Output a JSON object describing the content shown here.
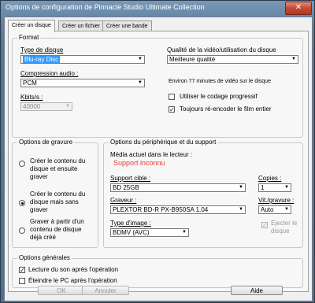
{
  "window": {
    "title": "Options de configuration de Pinnacle Studio Ultimate Collection",
    "close_glyph": "✕"
  },
  "tabs": [
    "Créer un disque",
    "Créer un fichier",
    "Créer une bande"
  ],
  "format": {
    "title": "Format",
    "disc_type_label": "Type de disque",
    "disc_type_value": "Blu-ray Disc",
    "audio_label": "Compression audio :",
    "audio_value": "PCM",
    "kbits_label": "Kbits/s :",
    "kbits_value": "40000",
    "quality_label": "Qualité de la vidéo/utilisation du disque",
    "quality_value": "Meilleure qualité",
    "info": "Environ 77 minutes de vidéo sur le disque",
    "progressive_label": "Utiliser le codage progressif",
    "reencode_label": "Toujours ré-encoder le film entier"
  },
  "burn": {
    "title": "Options de gravure",
    "opt1": "Créer le contenu du disque et ensuite graver",
    "opt2": "Créer le contenu du disque mais sans graver",
    "opt3": "Graver à partir d'un contenu de disque déjà créé"
  },
  "device": {
    "title": "Options du périphérique et du support",
    "media_label": "Média actuel dans le lecteur :",
    "media_value": "Support inconnu",
    "target_label": "Support cible :",
    "target_value": "BD 25GB",
    "copies_label": "Copies :",
    "copies_value": "1",
    "burner_label": "Graveur :",
    "burner_value": "PLEXTOR BD-R  PX-B950SA 1.04",
    "speed_label": "Vit./gravure :",
    "speed_value": "Auto",
    "image_label": "Type d'image :",
    "image_value": "BDMV (AVC)",
    "eject_label": "Éjecter le disque"
  },
  "general": {
    "title": "Options générales",
    "sound_label": "Lecture du son après l'opération",
    "shutdown_label": "Éteindre le PC après l'opération"
  },
  "buttons": {
    "ok": "OK",
    "cancel": "Annuler",
    "help": "Aide"
  },
  "icons": {
    "dropdown": "▼",
    "check": "✓"
  }
}
